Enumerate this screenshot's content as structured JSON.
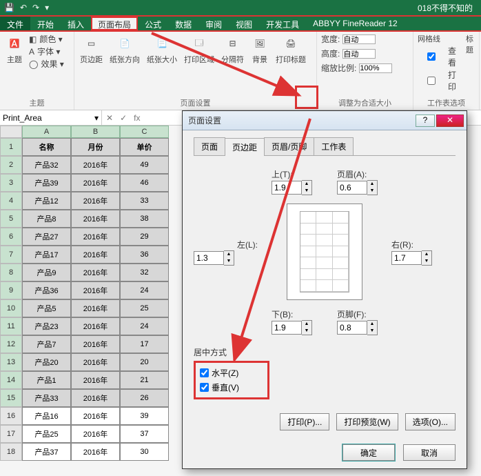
{
  "titlebar": {
    "doc_name": "018不得不知的"
  },
  "menu": {
    "file": "文件",
    "home": "开始",
    "insert": "插入",
    "layout": "页面布局",
    "formula": "公式",
    "data": "数据",
    "review": "审阅",
    "view": "视图",
    "dev": "开发工具",
    "abbyy": "ABBYY FineReader 12"
  },
  "ribbon": {
    "themes": {
      "btn": "主题",
      "color": "颜色 ▾",
      "font": "字体 ▾",
      "effect": "效果 ▾",
      "label": "主题"
    },
    "pagesetup": {
      "margins": "页边距",
      "orient": "纸张方向",
      "size": "纸张大小",
      "area": "打印区域",
      "breaks": "分隔符",
      "bg": "背景",
      "titles": "打印标题",
      "label": "页面设置"
    },
    "scale": {
      "width": "宽度:",
      "height": "高度:",
      "zoom": "缩放比例:",
      "auto1": "自动",
      "auto2": "自动",
      "zoomval": "100%",
      "label": "调整为合适大小"
    },
    "sheetopts": {
      "grid": "网格线",
      "headings": "标题",
      "view": "查看",
      "print": "打印",
      "label": "工作表选项"
    }
  },
  "namebox": {
    "value": "Print_Area",
    "fx": "fx"
  },
  "sheet": {
    "cols": [
      "A",
      "B",
      "C"
    ],
    "header": [
      "名称",
      "月份",
      "单价"
    ],
    "rows": [
      {
        "n": "2",
        "d": [
          "产品32",
          "2016年",
          "49"
        ]
      },
      {
        "n": "3",
        "d": [
          "产品39",
          "2016年",
          "46"
        ]
      },
      {
        "n": "4",
        "d": [
          "产品12",
          "2016年",
          "33"
        ]
      },
      {
        "n": "5",
        "d": [
          "产品8",
          "2016年",
          "38"
        ]
      },
      {
        "n": "6",
        "d": [
          "产品27",
          "2016年",
          "29"
        ]
      },
      {
        "n": "7",
        "d": [
          "产品17",
          "2016年",
          "36"
        ]
      },
      {
        "n": "8",
        "d": [
          "产品9",
          "2016年",
          "32"
        ]
      },
      {
        "n": "9",
        "d": [
          "产品36",
          "2016年",
          "24"
        ]
      },
      {
        "n": "10",
        "d": [
          "产品5",
          "2016年",
          "25"
        ]
      },
      {
        "n": "11",
        "d": [
          "产品23",
          "2016年",
          "24"
        ]
      },
      {
        "n": "12",
        "d": [
          "产品7",
          "2016年",
          "17"
        ]
      },
      {
        "n": "13",
        "d": [
          "产品20",
          "2016年",
          "20"
        ]
      },
      {
        "n": "14",
        "d": [
          "产品1",
          "2016年",
          "21"
        ]
      },
      {
        "n": "15",
        "d": [
          "产品33",
          "2016年",
          "26"
        ]
      },
      {
        "n": "16",
        "d": [
          "产品16",
          "2016年",
          "39"
        ]
      },
      {
        "n": "17",
        "d": [
          "产品25",
          "2016年",
          "37"
        ]
      },
      {
        "n": "18",
        "d": [
          "产品37",
          "2016年",
          "30"
        ]
      }
    ]
  },
  "dialog": {
    "title": "页面设置",
    "tabs": {
      "page": "页面",
      "margins": "页边距",
      "hf": "页眉/页脚",
      "sheet": "工作表"
    },
    "labels": {
      "top": "上(T):",
      "header": "页眉(A):",
      "left": "左(L):",
      "right": "右(R):",
      "bottom": "下(B):",
      "footer": "页脚(F):",
      "center": "居中方式",
      "horiz": "水平(Z)",
      "vert": "垂直(V)"
    },
    "values": {
      "top": "1.9",
      "header": "0.6",
      "left": "1.3",
      "right": "1.7",
      "bottom": "1.9",
      "footer": "0.8"
    },
    "buttons": {
      "print": "打印(P)...",
      "preview": "打印预览(W)",
      "options": "选项(O)...",
      "ok": "确定",
      "cancel": "取消"
    }
  }
}
